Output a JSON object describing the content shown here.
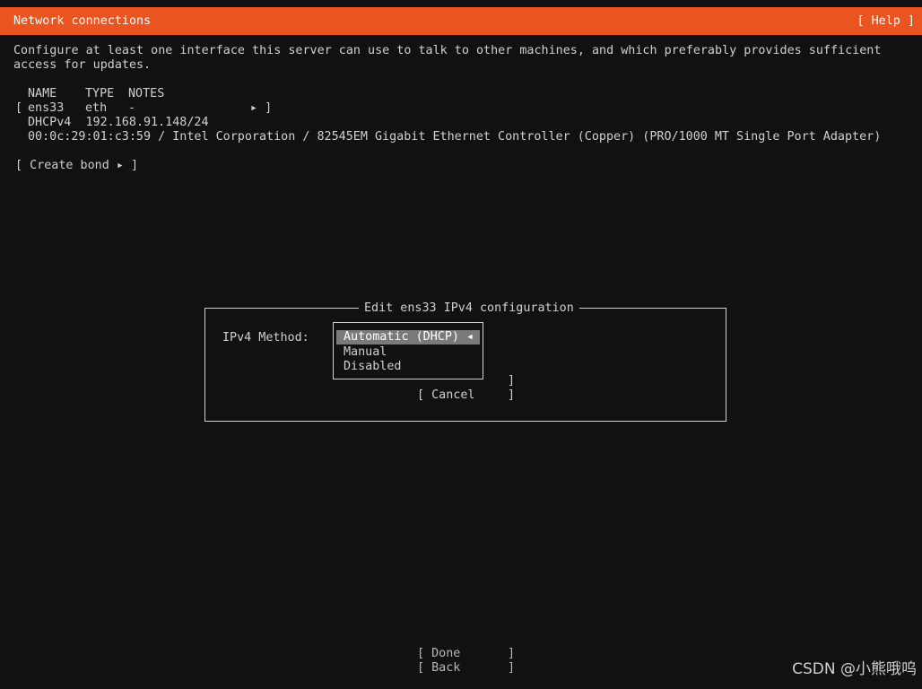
{
  "header": {
    "title": "Network connections",
    "help": "[ Help ]"
  },
  "description": {
    "line1": "Configure at least one interface this server can use to talk to other machines, and which preferably provides sufficient",
    "line2": "access for updates."
  },
  "table": {
    "columns": [
      "NAME",
      "TYPE",
      "NOTES"
    ],
    "rows": [
      {
        "name": "ens33",
        "type": "eth",
        "notes": "-",
        "open_bracket": "[",
        "arrow_close": "▸ ]",
        "detail1": "DHCPv4  192.168.91.148/24",
        "detail2": "00:0c:29:01:c3:59 / Intel Corporation / 82545EM Gigabit Ethernet Controller (Copper) (PRO/1000 MT Single Port Adapter)"
      }
    ]
  },
  "create_bond": "[ Create bond ▸ ]",
  "dialog": {
    "title": "Edit ens33 IPv4 configuration",
    "method_label": "IPv4 Method:",
    "options": [
      {
        "label": "Automatic (DHCP) ◂",
        "selected": true
      },
      {
        "label": "Manual",
        "selected": false
      },
      {
        "label": "Disabled",
        "selected": false
      }
    ],
    "stray_bracket": "]",
    "cancel_left": "[ Cancel",
    "cancel_right": "]"
  },
  "footer": {
    "done_left": "[ Done",
    "done_right": "]",
    "back_left": "[ Back",
    "back_right": "]"
  },
  "watermark": "CSDN @小熊哦呜",
  "colors": {
    "accent": "#e95420",
    "background": "#111111",
    "selected_bg": "#7a7a7a"
  }
}
